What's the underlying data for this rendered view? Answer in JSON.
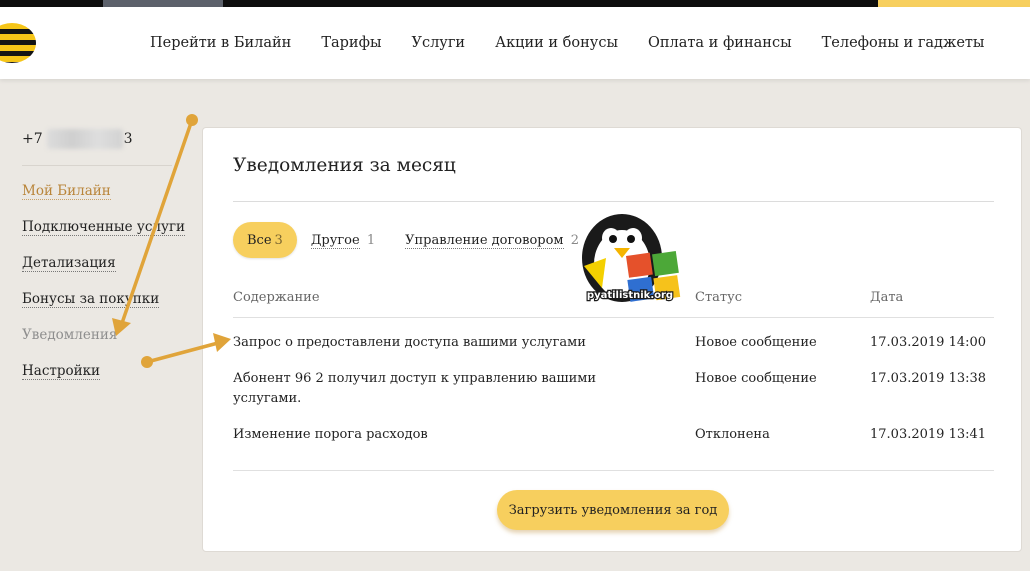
{
  "header": {
    "nav": [
      "Перейти в Билайн",
      "Тарифы",
      "Услуги",
      "Акции и бонусы",
      "Оплата и финансы",
      "Телефоны и гаджеты"
    ]
  },
  "sidebar": {
    "phone_prefix": "+7",
    "phone_suffix": "3",
    "items": [
      {
        "label": "Мой Билайн",
        "state": "active"
      },
      {
        "label": "Подключенные услуги",
        "state": "normal"
      },
      {
        "label": "Детализация",
        "state": "normal"
      },
      {
        "label": "Бонусы за покупки",
        "state": "normal"
      },
      {
        "label": "Уведомления",
        "state": "current"
      },
      {
        "label": "Настройки",
        "state": "normal"
      }
    ]
  },
  "main": {
    "title": "Уведомления за месяц",
    "tabs": [
      {
        "label": "Все",
        "count": "3"
      },
      {
        "label": "Другое",
        "count": "1"
      },
      {
        "label": "Управление договором",
        "count": "2"
      }
    ],
    "columns": [
      "Содержание",
      "Статус",
      "Дата"
    ],
    "rows": [
      {
        "content": "Запрос о предоставлени доступа вашими услугами",
        "status": "Новое сообщение",
        "date": "17.03.2019 14:00"
      },
      {
        "content": "Абонент 96 2 получил доступ к управлению вашими услугами.",
        "status": "Новое сообщение",
        "date": "17.03.2019 13:38"
      },
      {
        "content": "Изменение порога расходов",
        "status": "Отклонена",
        "date": "17.03.2019 13:41"
      }
    ],
    "load_button": "Загрузить уведомления за год"
  },
  "watermark": {
    "text": "pyatilistnik.org"
  },
  "colors": {
    "brand_yellow": "#f7cf5e",
    "annotation_arrow": "#e0a43a",
    "active_link": "#b9853a"
  }
}
